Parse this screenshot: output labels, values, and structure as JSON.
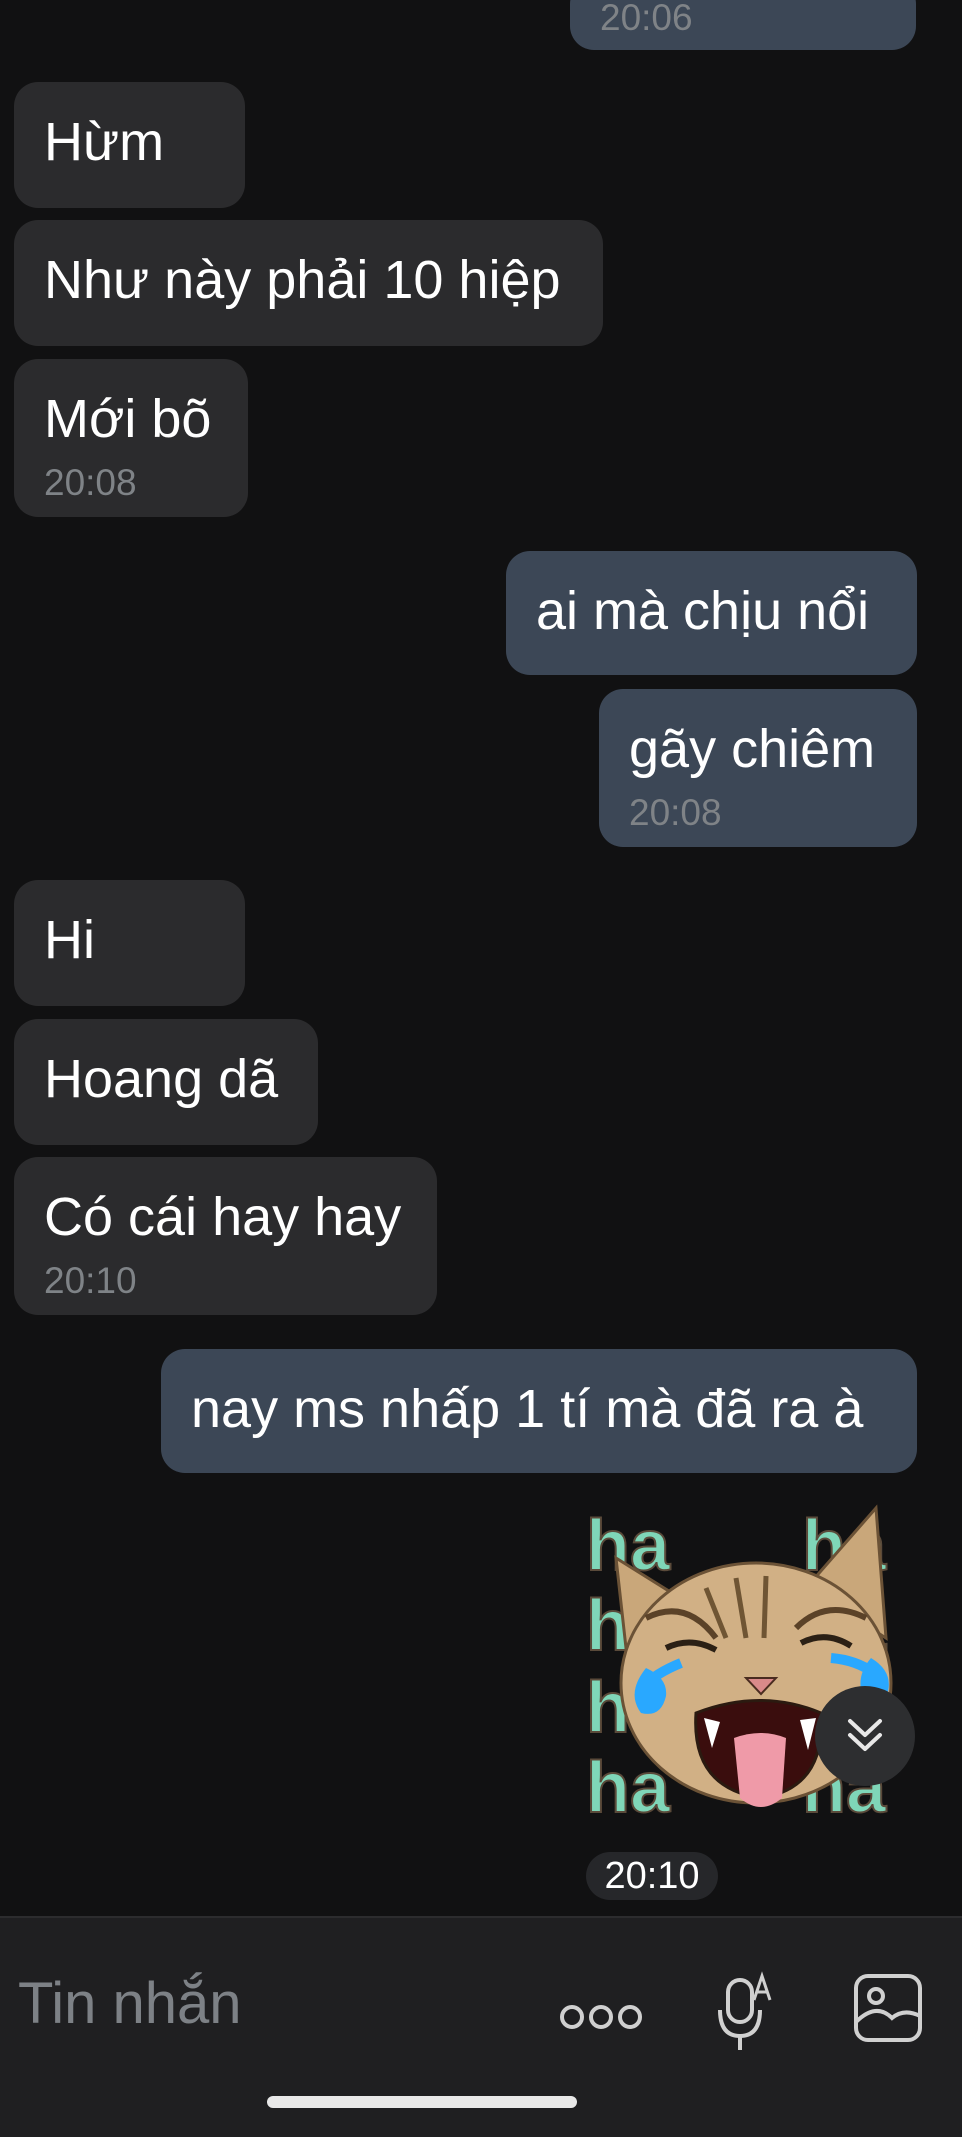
{
  "messages": [
    {
      "text": "",
      "time": "20:06",
      "side": "out"
    },
    {
      "text": "Hừm",
      "time": "",
      "side": "in"
    },
    {
      "text": "Như này phải 10 hiệp",
      "time": "",
      "side": "in"
    },
    {
      "text": "Mới bõ",
      "time": "20:08",
      "side": "in"
    },
    {
      "text": "ai mà chịu nổi",
      "time": "",
      "side": "out"
    },
    {
      "text": "gãy chiêm",
      "time": "20:08",
      "side": "out"
    },
    {
      "text": "Hi",
      "time": "",
      "side": "in"
    },
    {
      "text": "Hoang dã",
      "time": "",
      "side": "in"
    },
    {
      "text": "Có cái hay hay",
      "time": "20:10",
      "side": "in"
    },
    {
      "text": "nay ms nhấp 1 tí mà đã ra à",
      "time": "",
      "side": "out"
    }
  ],
  "sticker": {
    "words": [
      "ha",
      "ha",
      "ha",
      "ha",
      "ha",
      "ha",
      "ha",
      "ha"
    ],
    "time": "20:10",
    "icon": "laughing-cat-sticker"
  },
  "composer": {
    "placeholder": "Tin nhắn",
    "icons": [
      "more-options-icon",
      "voice-to-text-icon",
      "gallery-icon"
    ]
  },
  "colors": {
    "background": "#111112",
    "incoming_bubble": "#2b2b2d",
    "outgoing_bubble": "#3c4756",
    "timestamp": "#7f8387",
    "sticker_text": "#7fd6b8"
  }
}
